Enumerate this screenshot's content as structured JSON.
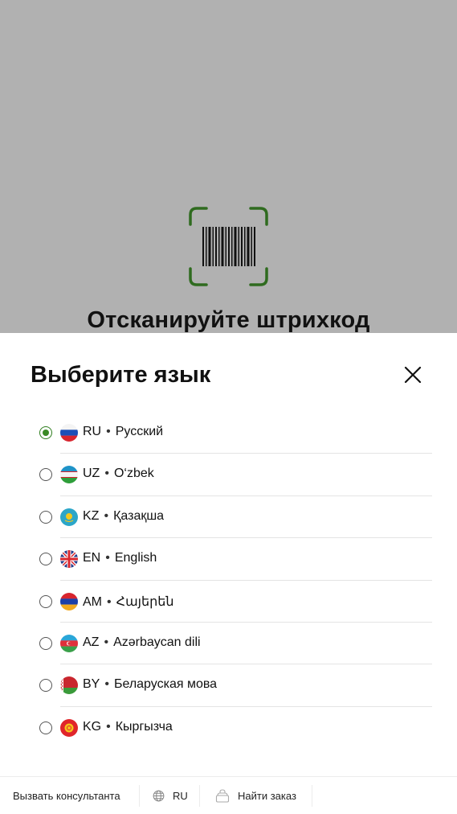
{
  "scanner": {
    "title": "Отсканируйте штрихкод",
    "frame_color": "#2f6b1f"
  },
  "language_sheet": {
    "title": "Выберите язык",
    "selected_code": "RU",
    "items": [
      {
        "code": "RU",
        "name": "Русский",
        "flag": "russia-flag-icon",
        "selected": true
      },
      {
        "code": "UZ",
        "name": "O‘zbek",
        "flag": "uzbekistan-flag-icon",
        "selected": false
      },
      {
        "code": "KZ",
        "name": "Қазақша",
        "flag": "kazakhstan-flag-icon",
        "selected": false
      },
      {
        "code": "EN",
        "name": "English",
        "flag": "uk-flag-icon",
        "selected": false
      },
      {
        "code": "AM",
        "name": "Հայերեն",
        "flag": "armenia-flag-icon",
        "selected": false
      },
      {
        "code": "AZ",
        "name": "Azərbaycan dili",
        "flag": "azerbaijan-flag-icon",
        "selected": false
      },
      {
        "code": "BY",
        "name": "Беларуская мова",
        "flag": "belarus-flag-icon",
        "selected": false
      },
      {
        "code": "KG",
        "name": "Кыргызча",
        "flag": "kyrgyzstan-flag-icon",
        "selected": false
      }
    ],
    "accent_color": "#3a8a25"
  },
  "footer": {
    "consultant_label": "Вызвать консультанта",
    "language_label": "RU",
    "language_icon": "globe-icon",
    "find_order_label": "Найти заказ",
    "find_order_icon": "bag-icon"
  }
}
